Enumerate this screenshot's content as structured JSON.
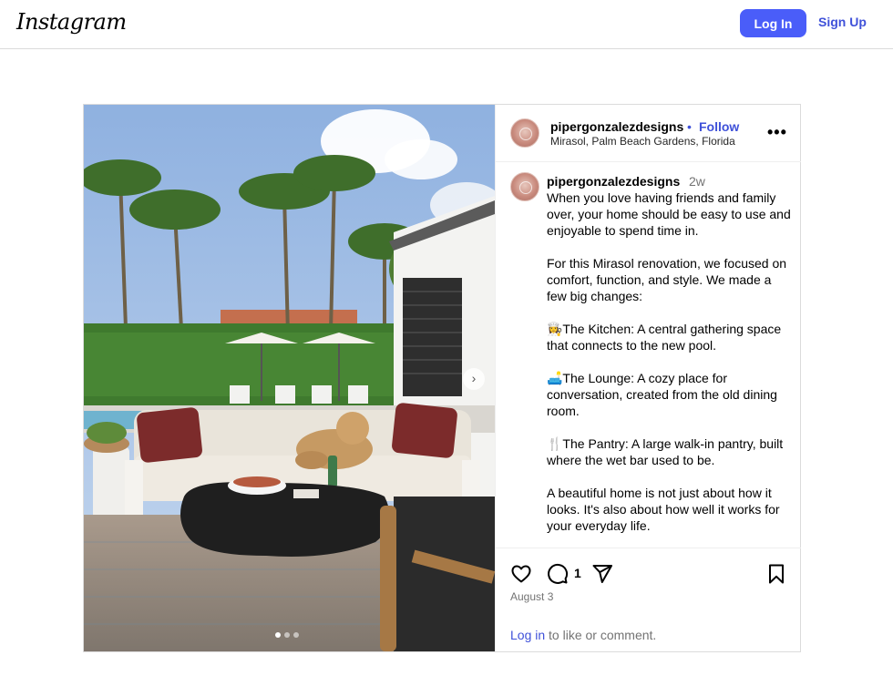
{
  "topbar": {
    "logo": "Instagram",
    "login_label": "Log In",
    "signup_label": "Sign Up"
  },
  "post": {
    "header": {
      "username": "pipergonzalezdesigns",
      "separator": "•",
      "follow_label": "Follow",
      "location": "Mirasol, Palm Beach Gardens, Florida"
    },
    "caption": {
      "username": "pipergonzalezdesigns",
      "time": "2w",
      "text": "When you love having friends and family over, your home should be easy to use and enjoyable to spend time in.\n\nFor this Mirasol renovation, we focused on comfort, function, and style. We made a few big changes:\n\n👩‍🍳The Kitchen: A central gathering space that connects to the new pool.\n\n🛋️The Lounge: A cozy place for conversation, created from the old dining room.\n\n🍴The Pantry: A large walk-in pantry, built where the wet bar used to be.\n\nA beautiful home is not just about how it looks. It's also about how well it works for your everyday life."
    },
    "actions": {
      "comment_count": "1",
      "date": "August 3",
      "login_link": "Log in",
      "login_suffix": " to like or comment."
    },
    "carousel": {
      "slide_count": 3,
      "active_index": 0,
      "next_icon": "chevron-right-icon"
    }
  }
}
